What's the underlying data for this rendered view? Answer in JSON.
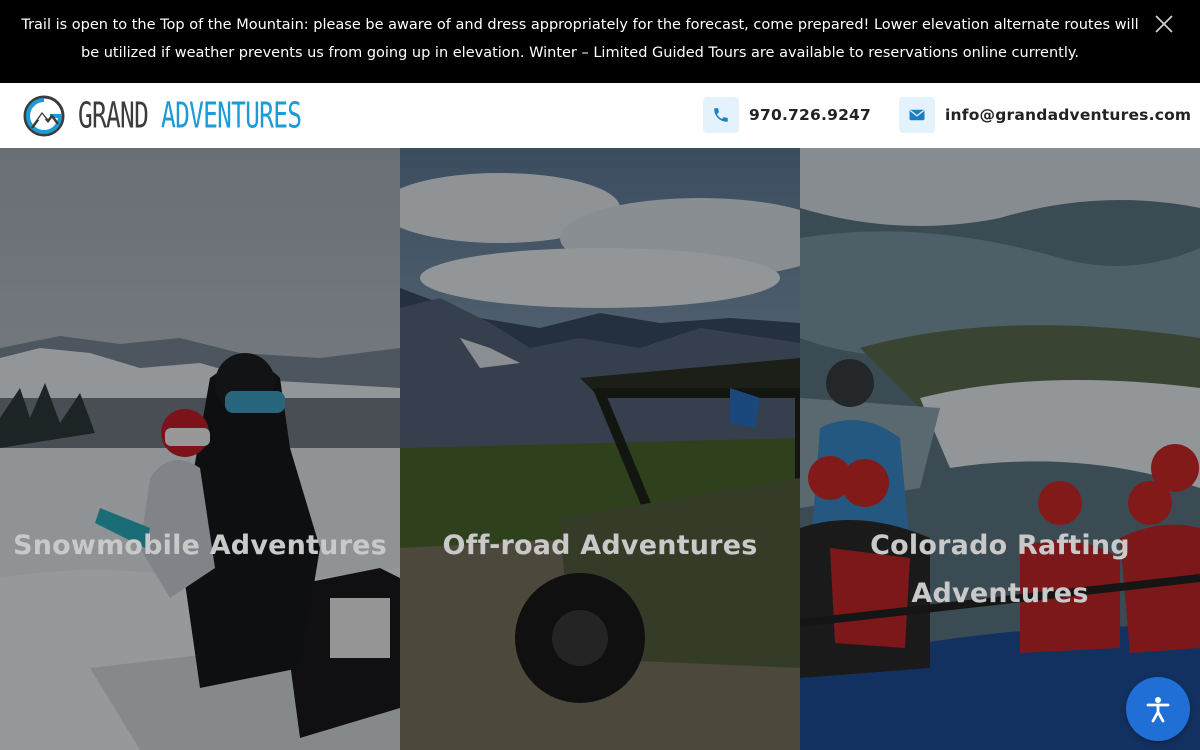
{
  "alert": {
    "message": "Trail is open to the Top of the Mountain: please be aware of and dress appropriately for the forecast, come prepared! Lower elevation alternate routes will be utilized if weather prevents us from going up in elevation. Winter – Limited Guided Tours are available to reservations online currently.",
    "close_icon": "close-icon"
  },
  "header": {
    "logo": {
      "word1": "GRAND",
      "word2": "ADVENTURES"
    },
    "phone": {
      "icon": "phone-icon",
      "text": "970.726.9247"
    },
    "email": {
      "icon": "envelope-icon",
      "text": "info@grandadventures.com"
    }
  },
  "panels": [
    {
      "title": "Snowmobile Adventures"
    },
    {
      "title": "Off-road Adventures"
    },
    {
      "title": "Colorado Rafting Adventures"
    }
  ],
  "accessibility": {
    "icon": "accessibility-icon"
  },
  "colors": {
    "brand_blue": "#1b9bd7",
    "banner_bg": "#000000",
    "a11y_button": "#1f6fd6"
  }
}
